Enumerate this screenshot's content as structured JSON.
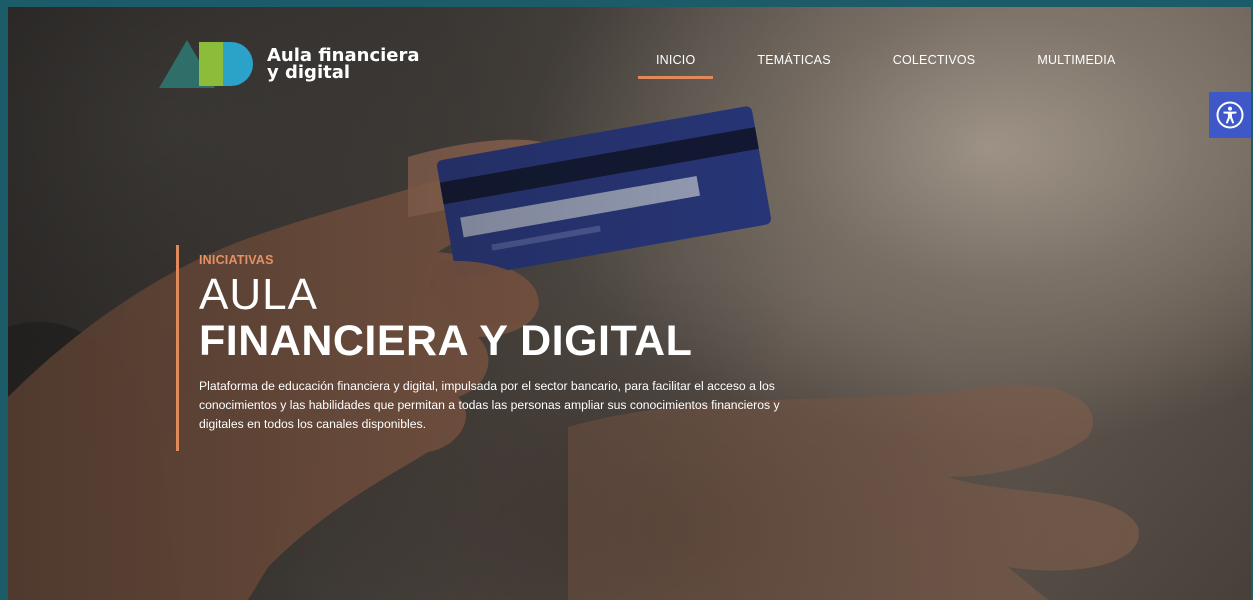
{
  "brand": {
    "name_line1": "Aula financiera",
    "name_line2": "y digital",
    "colors": {
      "triangle": "#2f6f6a",
      "green": "#8bbd3a",
      "blue": "#2ba3c9",
      "accent": "#e08a5b"
    }
  },
  "nav": {
    "items": [
      {
        "label": "INICIO",
        "active": true
      },
      {
        "label": "TEMÁTICAS",
        "active": false
      },
      {
        "label": "COLECTIVOS",
        "active": false
      },
      {
        "label": "MULTIMEDIA",
        "active": false
      }
    ]
  },
  "accessibility": {
    "icon": "accessibility-icon"
  },
  "hero": {
    "eyebrow": "INICIATIVAS",
    "title_line1": "AULA",
    "title_line2": "FINANCIERA Y DIGITAL",
    "description": "Plataforma de educación financiera y digital, impulsada por el sector bancario, para facilitar el acceso a los conocimientos y las habilidades que permitan a todas las personas ampliar sus conocimientos financieros y digitales en todos los canales disponibles."
  }
}
